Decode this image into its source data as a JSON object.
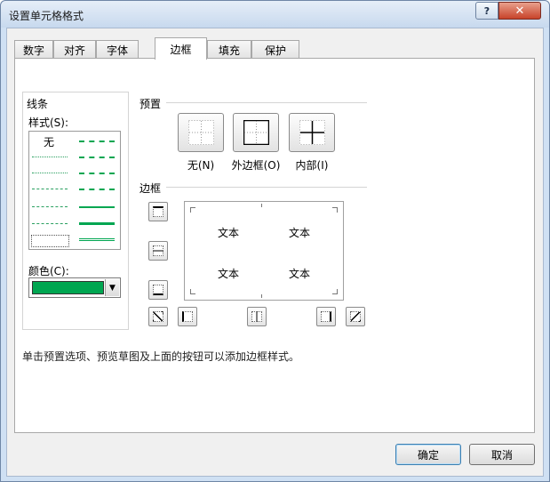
{
  "window": {
    "title": "设置单元格格式",
    "help_label": "?",
    "close_label": "✕"
  },
  "tabs": [
    {
      "label": "数字",
      "active": false
    },
    {
      "label": "对齐",
      "active": false
    },
    {
      "label": "字体",
      "active": false
    },
    {
      "label": "边框",
      "active": true
    },
    {
      "label": "填充",
      "active": false
    },
    {
      "label": "保护",
      "active": false
    }
  ],
  "line_group": {
    "title": "线条",
    "style_label": "样式(S):",
    "none_label": "无",
    "color_label": "颜色(C):",
    "selected_color": "#00a651"
  },
  "presets": {
    "title": "预置",
    "items": [
      {
        "label": "无(N)",
        "icon": "border-none-icon"
      },
      {
        "label": "外边框(O)",
        "icon": "border-outline-icon"
      },
      {
        "label": "内部(I)",
        "icon": "border-inside-icon"
      }
    ]
  },
  "border": {
    "title": "边框",
    "preview_text": [
      "文本",
      "文本",
      "文本",
      "文本"
    ]
  },
  "hint": "单击预置选项、预览草图及上面的按钮可以添加边框样式。",
  "buttons": {
    "ok": "确定",
    "cancel": "取消"
  }
}
